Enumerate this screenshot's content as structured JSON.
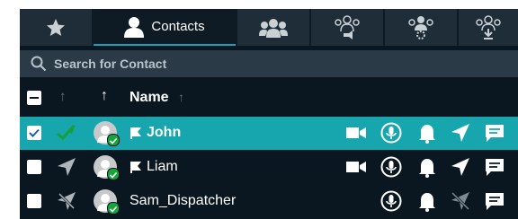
{
  "tabs": [
    {
      "icon": "star-icon",
      "label": ""
    },
    {
      "icon": "person-icon",
      "label": "Contacts",
      "active": true
    },
    {
      "icon": "group-icon",
      "label": ""
    },
    {
      "icon": "broadcast-group-icon",
      "label": ""
    },
    {
      "icon": "group-settings-icon",
      "label": ""
    },
    {
      "icon": "group-download-icon",
      "label": ""
    }
  ],
  "search": {
    "placeholder": "Search for Contact"
  },
  "header": {
    "name_label": "Name"
  },
  "contacts": [
    {
      "name": "John",
      "selected": true,
      "checked": true,
      "status": "green-check",
      "actions": [
        "video",
        "mic",
        "bell",
        "locate",
        "message"
      ]
    },
    {
      "name": "Liam",
      "selected": false,
      "checked": false,
      "status": "location",
      "actions": [
        "video",
        "mic",
        "bell",
        "locate",
        "message"
      ]
    },
    {
      "name": "Sam_Dispatcher",
      "selected": false,
      "checked": false,
      "status": "no-location",
      "actions": [
        "mic",
        "bell",
        "no-locate",
        "message"
      ]
    }
  ],
  "colors": {
    "panel": "#0b1720",
    "tab": "#1e2d38",
    "accent": "#17a6ae",
    "online": "#18a33c"
  }
}
